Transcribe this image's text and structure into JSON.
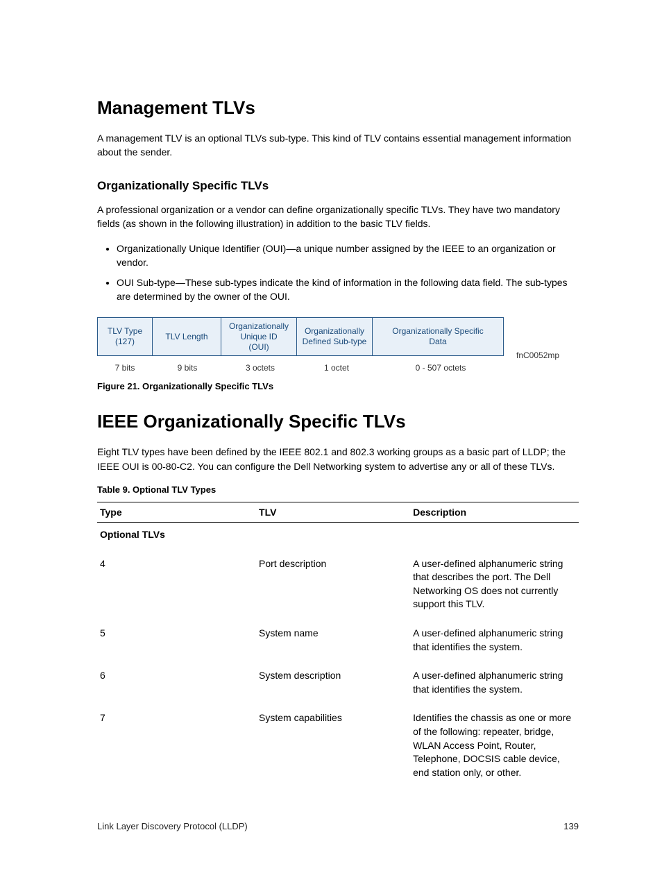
{
  "heading1": "Management TLVs",
  "para1": "A management TLV is an optional TLVs sub-type. This kind of TLV contains essential management information about the sender.",
  "subheading1": "Organizationally Specific TLVs",
  "para2": "A professional organization or a vendor can define organizationally specific TLVs. They have two mandatory fields (as shown in the following illustration) in addition to the basic TLV fields.",
  "bullets": [
    "Organizationally Unique Identifier (OUI)—a unique number assigned by the IEEE to an organization or vendor.",
    "OUI Sub-type—These sub-types indicate the kind of information in the following data field. The sub-types are determined by the owner of the OUI."
  ],
  "diagram": {
    "boxes": [
      {
        "l1": "TLV Type",
        "l2": "(127)"
      },
      {
        "l1": "TLV Length",
        "l2": ""
      },
      {
        "l1": "Organizationally",
        "l2": "Unique ID",
        "l3": "(OUI)"
      },
      {
        "l1": "Organizationally",
        "l2": "Defined Sub-type"
      },
      {
        "l1": "Organizationally Specific",
        "l2": "Data"
      }
    ],
    "legends": [
      "7 bits",
      "9 bits",
      "3 octets",
      "1 octet",
      "0 - 507 octets"
    ],
    "ref": "fnC0052mp"
  },
  "fig_caption": "Figure 21. Organizationally Specific TLVs",
  "heading2": "IEEE Organizationally Specific TLVs",
  "para3": "Eight TLV types have been defined by the IEEE 802.1 and 802.3 working groups as a basic part of LLDP; the IEEE OUI is 00-80-C2. You can configure the Dell Networking system to advertise any or all of these TLVs.",
  "table_caption": "Table 9. Optional TLV Types",
  "table": {
    "headers": [
      "Type",
      "TLV",
      "Description"
    ],
    "section": "Optional TLVs",
    "rows": [
      {
        "type": "4",
        "tlv": "Port description",
        "desc": "A user-defined alphanumeric string that describes the port. The Dell Networking OS does not currently support this TLV."
      },
      {
        "type": "5",
        "tlv": "System name",
        "desc": "A user-defined alphanumeric string that identifies the system."
      },
      {
        "type": "6",
        "tlv": "System description",
        "desc": "A user-defined alphanumeric string that identifies the system."
      },
      {
        "type": "7",
        "tlv": "System capabilities",
        "desc": "Identifies the chassis as one or more of the following: repeater, bridge, WLAN Access Point, Router, Telephone, DOCSIS cable device, end station only, or other."
      }
    ]
  },
  "footer": {
    "left": "Link Layer Discovery Protocol (LLDP)",
    "right": "139"
  }
}
